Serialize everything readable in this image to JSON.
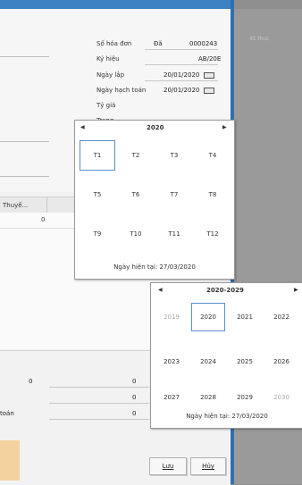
{
  "header": {
    "invoice_no_label": "Số hóa đơn",
    "invoice_no_button": "Đã",
    "invoice_no_value": "0000243",
    "symbol_label": "Ký hiệu",
    "symbol_value": "AB/20E",
    "date_label": "Ngày lập",
    "date_value": "20/01/2020",
    "acct_date_label": "Ngày hạch toán",
    "acct_date_value": "20/01/2020",
    "rate_label": "Tỷ giá",
    "status_label": "Trạng"
  },
  "right_panel": {
    "text": "Kt thuc"
  },
  "grid": {
    "col_tax": "Thuyế...",
    "row_value": "0"
  },
  "footer": {
    "amount_left": "0",
    "values": [
      "0",
      "0",
      "0"
    ],
    "total_label": "toán"
  },
  "buttons": {
    "save": "Lưu",
    "cancel": "Hủy"
  },
  "month_picker": {
    "year": "2020",
    "months": [
      "T1",
      "T2",
      "T3",
      "T4",
      "T5",
      "T6",
      "T7",
      "T8",
      "T9",
      "T10",
      "T11",
      "T12"
    ],
    "today": "Ngày hiện tại: 27/03/2020"
  },
  "year_picker": {
    "range": "2020-2029",
    "years": [
      "2019",
      "2020",
      "2021",
      "2022",
      "2023",
      "2024",
      "2025",
      "2026",
      "2027",
      "2028",
      "2029",
      "2030"
    ],
    "today": "Ngày hiện tại: 27/03/2020"
  }
}
